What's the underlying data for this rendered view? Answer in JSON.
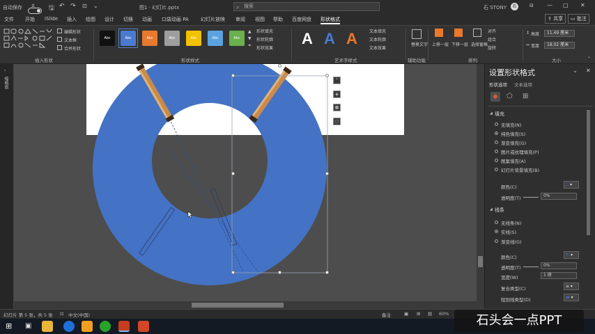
{
  "titlebar": {
    "autosave_label": "自动保存",
    "toggle_state": "关",
    "doc_title": "图1 · 幻灯片.pptx",
    "search_placeholder": "搜索",
    "user": "石 STONY",
    "user_initial": "石",
    "window_controls": [
      "—",
      "□",
      "✕"
    ]
  },
  "tabs": {
    "items": [
      "文件",
      "开始",
      "iSlide",
      "插入",
      "绘图",
      "设计",
      "切换",
      "动画",
      "口袋动画 PA",
      "幻灯片放映",
      "审阅",
      "视图",
      "帮助",
      "百度网盘",
      "形状格式"
    ],
    "active": "形状格式",
    "share_label": "共享",
    "comment_label": "批注"
  },
  "ribbon": {
    "groups": {
      "insert_shapes": "插入形状",
      "shape_styles": "形状样式",
      "art_styles": "艺术字样式",
      "accessibility": "辅助功能",
      "arrange": "排列",
      "size": "大小"
    },
    "insert_items": [
      "编辑形状",
      "文本框",
      "合并形状"
    ],
    "style_tile_text": "Abc",
    "style_colors": [
      "#111111",
      "#4a7bd0",
      "#e9792c",
      "#9e9e9e",
      "#f2c200",
      "#5ba3e0",
      "#6ab04c"
    ],
    "shape_opts": [
      "形状填充",
      "形状轮廓",
      "形状效果"
    ],
    "text_opts": [
      "文本填充",
      "文本轮廓",
      "文本效果"
    ],
    "wordart_letters": [
      "A",
      "A",
      "A"
    ],
    "accessibility_btn": "替换文字",
    "arrange_btns": [
      "上移一层",
      "下移一层",
      "选择窗格"
    ],
    "arrange_small": [
      "对齐",
      "组合",
      "旋转"
    ],
    "height_label": "高度",
    "height": "11.49 厘米",
    "width_label": "宽度",
    "width": "18.02 厘米"
  },
  "leftrail": {
    "label": "缩略图"
  },
  "pane": {
    "title": "设置形状格式",
    "tabs": [
      "形状选项",
      "文本选项"
    ],
    "fill": {
      "header": "填充",
      "options": [
        "无填充(N)",
        "纯色填充(S)",
        "渐变填充(G)",
        "图片或纹理填充(P)",
        "图案填充(A)",
        "幻灯片背景填充(B)"
      ],
      "selected": 1,
      "color_label": "颜色(C)",
      "transparency_label": "透明度(T)",
      "transparency": "0%"
    },
    "line": {
      "header": "线条",
      "options": [
        "无线条(N)",
        "实线(S)",
        "渐变线(G)"
      ],
      "selected": 1,
      "color_label": "颜色(C)",
      "transparency_label": "透明度(T)",
      "transparency": "0%",
      "width_label": "宽度(W)",
      "width": "1 磅",
      "compound_label": "复合类型(C)",
      "dash_label": "短划线类型(D)"
    }
  },
  "status": {
    "slide": "幻灯片 第 5 张，共 5 张",
    "lang": "中文(中国)",
    "notes": "备注",
    "zoom": "60%"
  },
  "watermark": "石头会一点PPT",
  "colors": {
    "ring": "#4472c4",
    "wood_light": "#e2b27a",
    "wood_dark": "#a8713d",
    "cap": "#3a2a1a"
  }
}
